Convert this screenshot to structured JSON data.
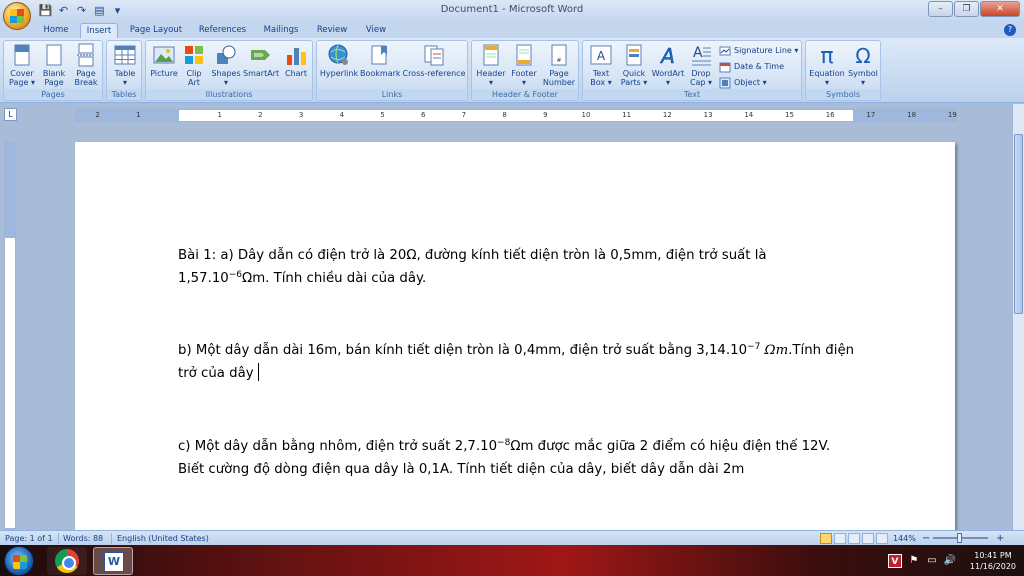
{
  "window": {
    "title": "Document1 - Microsoft Word",
    "minimize": "–",
    "maximize": "❐",
    "close": "✕"
  },
  "qat": {
    "save": "💾",
    "undo": "↶",
    "redo": "↷",
    "print": "▤",
    "more": "▾"
  },
  "tabs": [
    "Home",
    "Insert",
    "Page Layout",
    "References",
    "Mailings",
    "Review",
    "View"
  ],
  "active_tab": "Insert",
  "ribbon": {
    "groups": {
      "pages": "Pages",
      "tables": "Tables",
      "illustrations": "Illustrations",
      "links": "Links",
      "header_footer": "Header & Footer",
      "text": "Text",
      "symbols": "Symbols"
    },
    "buttons": {
      "cover_page": [
        "Cover",
        "Page ▾"
      ],
      "blank_page": [
        "Blank",
        "Page"
      ],
      "page_break": [
        "Page",
        "Break"
      ],
      "table": [
        "Table",
        "▾"
      ],
      "picture": "Picture",
      "clip_art": [
        "Clip",
        "Art"
      ],
      "shapes": [
        "Shapes",
        "▾"
      ],
      "smartart": "SmartArt",
      "chart": "Chart",
      "hyperlink": "Hyperlink",
      "bookmark": "Bookmark",
      "cross_reference": "Cross-reference",
      "header": [
        "Header",
        "▾"
      ],
      "footer": [
        "Footer",
        "▾"
      ],
      "page_number": [
        "Page",
        "Number ▾"
      ],
      "text_box": [
        "Text",
        "Box ▾"
      ],
      "quick_parts": [
        "Quick",
        "Parts ▾"
      ],
      "wordart": [
        "WordArt",
        "▾"
      ],
      "drop_cap": [
        "Drop",
        "Cap ▾"
      ],
      "signature_line": "Signature Line ▾",
      "date_time": "Date & Time",
      "object": "Object ▾",
      "equation": [
        "Equation",
        "▾"
      ],
      "symbol": [
        "Symbol",
        "▾"
      ]
    }
  },
  "ruler": {
    "labels": [
      "2",
      "1",
      "1",
      "2",
      "3",
      "4",
      "5",
      "6",
      "7",
      "8",
      "9",
      "10",
      "11",
      "12",
      "13",
      "14",
      "15",
      "16",
      "17",
      "18",
      "19"
    ],
    "corner": "L"
  },
  "document": {
    "p1_a": "Bài 1: a) Dây dẫn có điện trở là 20Ω, đường kính tiết diện tròn là 0,5mm, điện trở suất là 1,57.10",
    "p1_exp": "−6",
    "p1_b": "Ωm. Tính chiều dài của dây.",
    "p2_a": "b) Một dây dẫn dài 16m, bán kính tiết diện tròn là 0,4mm, điện trở suất bằng 3,14.10",
    "p2_exp": "−7",
    "p2_unit": " Ωm",
    "p2_b": ".Tính điện trở của dây",
    "p3_a": "c) Một dây dẫn bằng nhôm, điện trở suất 2,7.10",
    "p3_exp": "−8",
    "p3_b": "Ωm được mắc giữa 2 điểm có hiệu điện thế 12V. Biết cường độ dòng điện qua dây là 0,1A. Tính tiết diện của dây, biết dây dẫn dài 2m"
  },
  "status": {
    "page": "Page: 1 of 1",
    "words": "Words: 88",
    "language": "English (United States)",
    "zoom": "144%",
    "zoom_minus": "−",
    "zoom_plus": "+"
  },
  "taskbar": {
    "lang": "V",
    "time": "10:41 PM",
    "date": "11/16/2020",
    "tray_icons": [
      "⚑",
      "▭",
      "🔊"
    ]
  },
  "colors": {
    "ribbon_text": "#15428b",
    "taskbar_red": "#a01717",
    "page_bg": "#ffffff"
  }
}
